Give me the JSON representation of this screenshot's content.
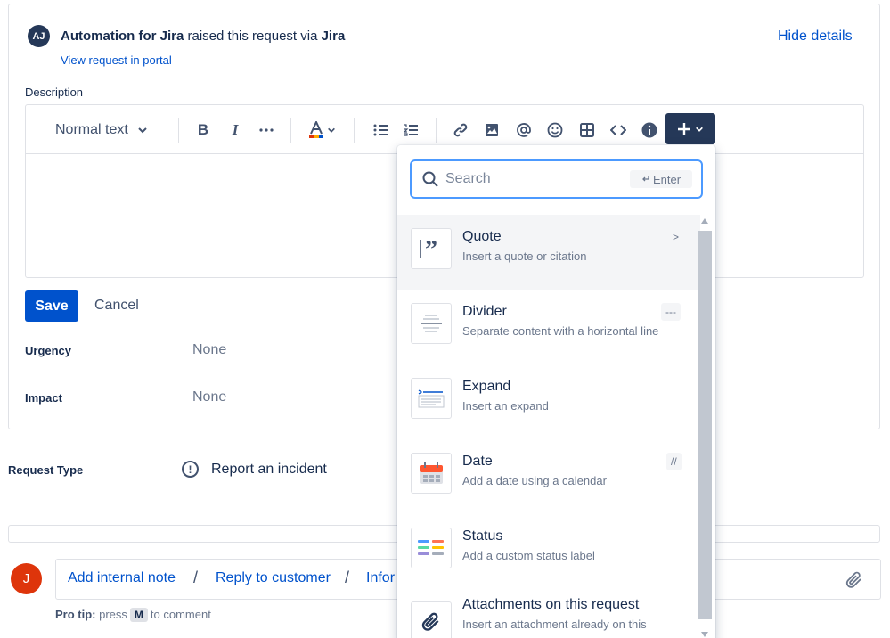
{
  "header": {
    "avatar_initials": "AJ",
    "requester": "Automation for Jira",
    "raised_text": "raised this request via",
    "channel": "Jira",
    "view_portal": "View request in portal",
    "hide_details": "Hide details"
  },
  "description": {
    "label": "Description",
    "toolbar": {
      "text_style": "Normal text",
      "bold": "B",
      "italic": "I"
    }
  },
  "actions": {
    "save": "Save",
    "cancel": "Cancel"
  },
  "fields": [
    {
      "label": "Urgency",
      "value": "None"
    },
    {
      "label": "Impact",
      "value": "None"
    }
  ],
  "request_type": {
    "label": "Request Type",
    "icon": "!",
    "value": "Report an incident"
  },
  "insert_menu": {
    "search": {
      "placeholder": "Search",
      "enter_hint": "Enter"
    },
    "items": [
      {
        "title": "Quote",
        "description": "Insert a quote or citation",
        "shortcut": ">",
        "icon": "quote-icon"
      },
      {
        "title": "Divider",
        "description": "Separate content with a horizontal line",
        "shortcut": "---",
        "icon": "divider-icon"
      },
      {
        "title": "Expand",
        "description": "Insert an expand",
        "shortcut": "",
        "icon": "expand-icon"
      },
      {
        "title": "Date",
        "description": "Add a date using a calendar",
        "shortcut": "//",
        "icon": "calendar-icon"
      },
      {
        "title": "Status",
        "description": "Add a custom status label",
        "shortcut": "",
        "icon": "status-icon"
      },
      {
        "title": "Attachments on this request",
        "description": "Insert an attachment already on this",
        "shortcut": "",
        "icon": "attachment-icon"
      }
    ]
  },
  "comment": {
    "avatar_initial": "J",
    "tabs": [
      "Add internal note",
      "Reply to customer",
      "Infor"
    ],
    "protip_label": "Pro tip:",
    "protip_press": "press",
    "protip_key": "M",
    "protip_rest": "to comment"
  },
  "colors": {
    "link": "#0052cc",
    "primary_button": "#0052cc",
    "dark_button": "#253858",
    "avatar_j": "#de350b",
    "search_focus": "#4c9aff"
  }
}
